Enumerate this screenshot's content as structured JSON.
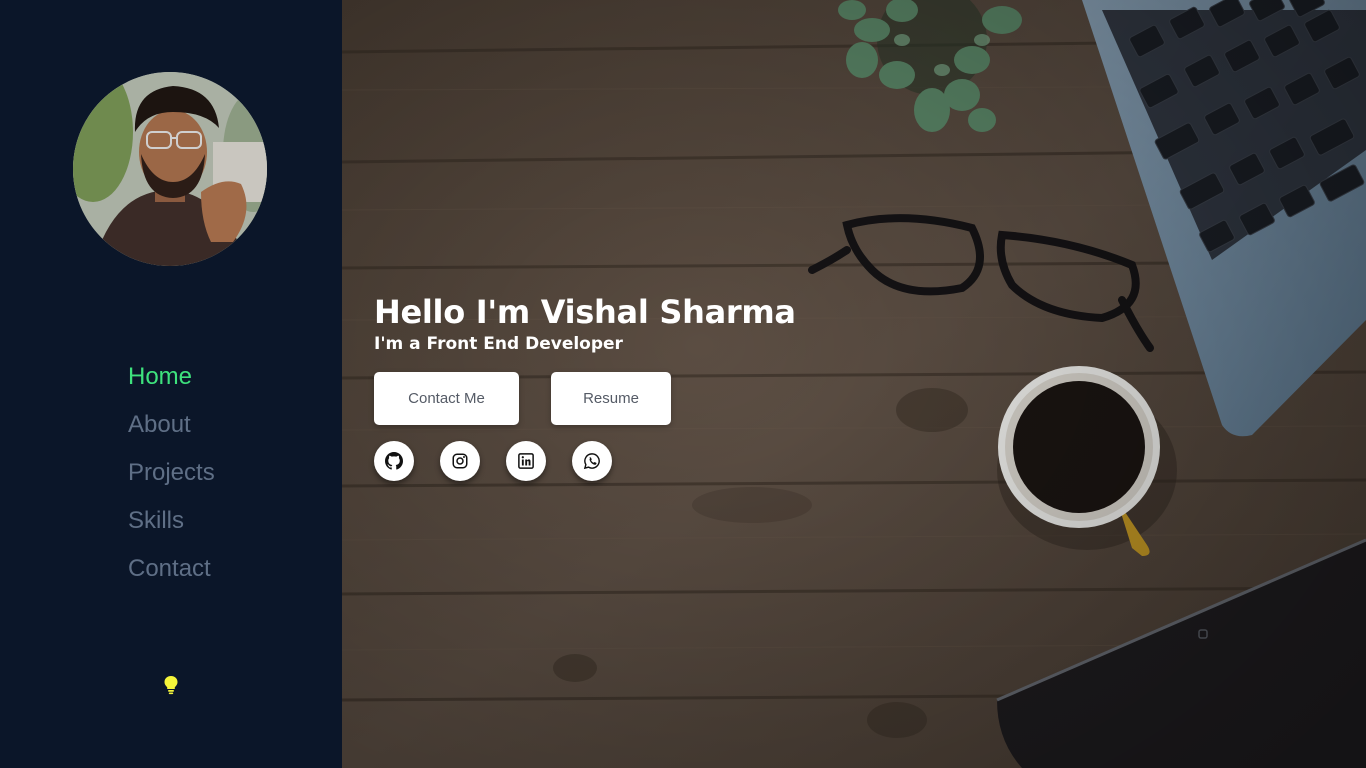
{
  "sidebar": {
    "nav": [
      {
        "label": "Home",
        "active": true
      },
      {
        "label": "About",
        "active": false
      },
      {
        "label": "Projects",
        "active": false
      },
      {
        "label": "Skills",
        "active": false
      },
      {
        "label": "Contact",
        "active": false
      }
    ],
    "theme_toggle_icon": "lightbulb-icon"
  },
  "hero": {
    "greeting": "Hello I'm Vishal Sharma",
    "role": "I'm a Front End Developer",
    "buttons": {
      "contact": "Contact Me",
      "resume": "Resume"
    },
    "socials": [
      "github-icon",
      "instagram-icon",
      "linkedin-icon",
      "whatsapp-icon"
    ]
  },
  "colors": {
    "sidebar_bg": "#0b1629",
    "nav_active": "#3ee27d",
    "nav_inactive": "#5f6f86",
    "bulb": "#f5f53a"
  }
}
